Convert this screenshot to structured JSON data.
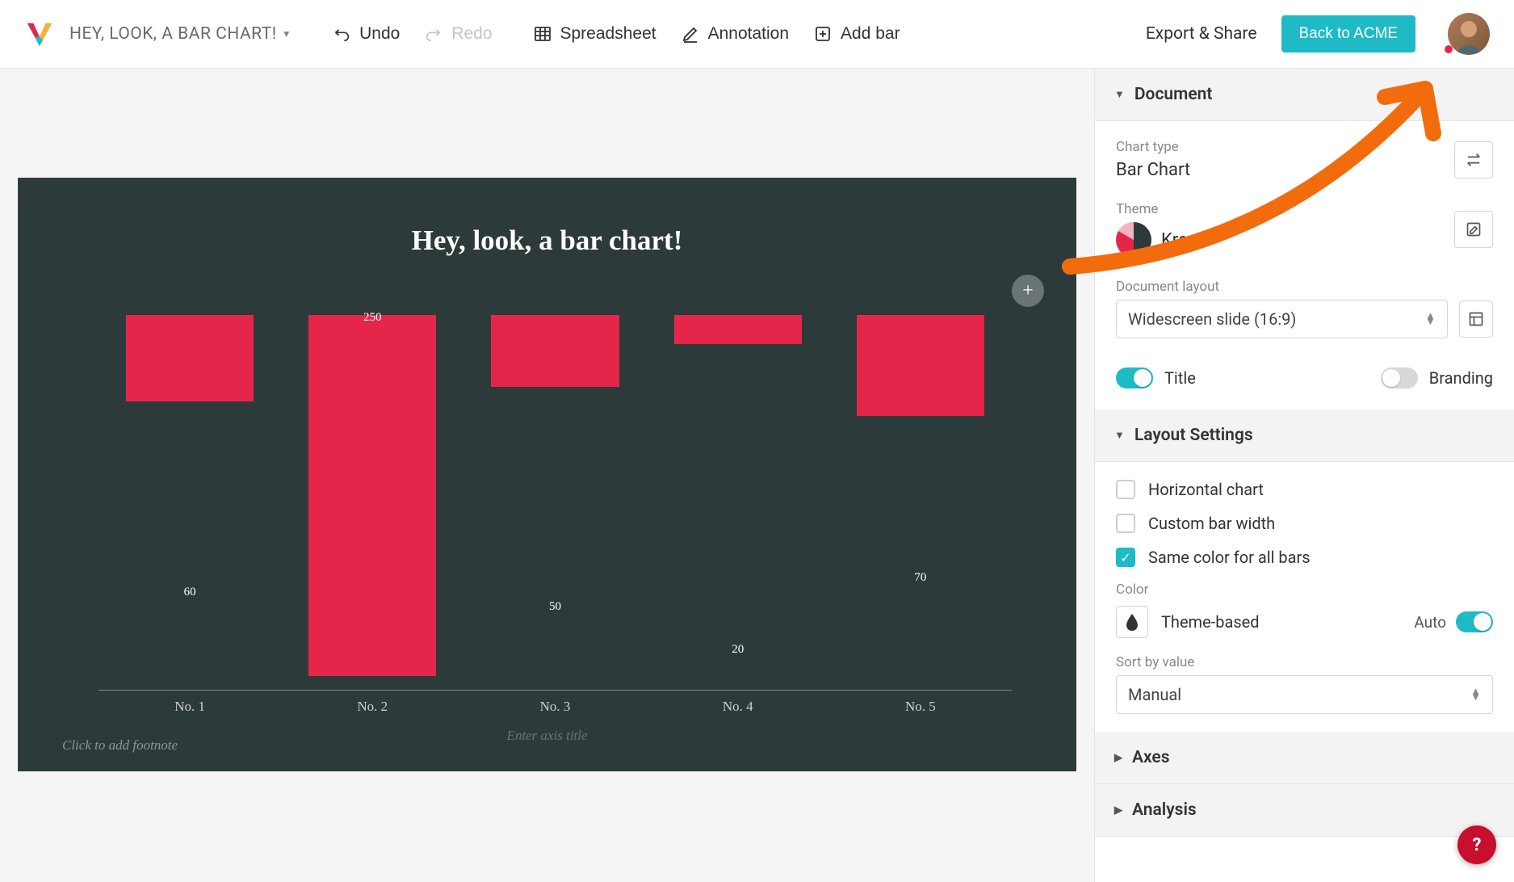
{
  "header": {
    "doc_title": "HEY, LOOK, A BAR CHART!",
    "undo": "Undo",
    "redo": "Redo",
    "spreadsheet": "Spreadsheet",
    "annotation": "Annotation",
    "add_bar": "Add bar",
    "export_share": "Export & Share",
    "back_button": "Back to ACME"
  },
  "chart": {
    "title": "Hey, look, a bar chart!",
    "axis_placeholder": "Enter axis title",
    "footnote_placeholder": "Click to add footnote"
  },
  "chart_data": {
    "type": "bar",
    "title": "Hey, look, a bar chart!",
    "categories": [
      "No. 1",
      "No. 2",
      "No. 3",
      "No. 4",
      "No. 5"
    ],
    "values": [
      60,
      250,
      50,
      20,
      70
    ],
    "xlabel": "",
    "ylabel": "",
    "ylim": [
      0,
      260
    ],
    "bar_color": "#e6254b"
  },
  "sidebar": {
    "document": {
      "header": "Document",
      "chart_type_label": "Chart type",
      "chart_type_value": "Bar Chart",
      "theme_label": "Theme",
      "theme_value": "Kreon",
      "layout_label": "Document layout",
      "layout_value": "Widescreen slide (16:9)",
      "title_toggle_label": "Title",
      "branding_toggle_label": "Branding"
    },
    "layout_settings": {
      "header": "Layout Settings",
      "horizontal_chart": "Horizontal chart",
      "custom_bar_width": "Custom bar width",
      "same_color": "Same color for all bars",
      "color_label": "Color",
      "color_value": "Theme-based",
      "auto_label": "Auto",
      "sort_label": "Sort by value",
      "sort_value": "Manual"
    },
    "axes": {
      "header": "Axes"
    },
    "analysis": {
      "header": "Analysis"
    }
  },
  "help": "?"
}
